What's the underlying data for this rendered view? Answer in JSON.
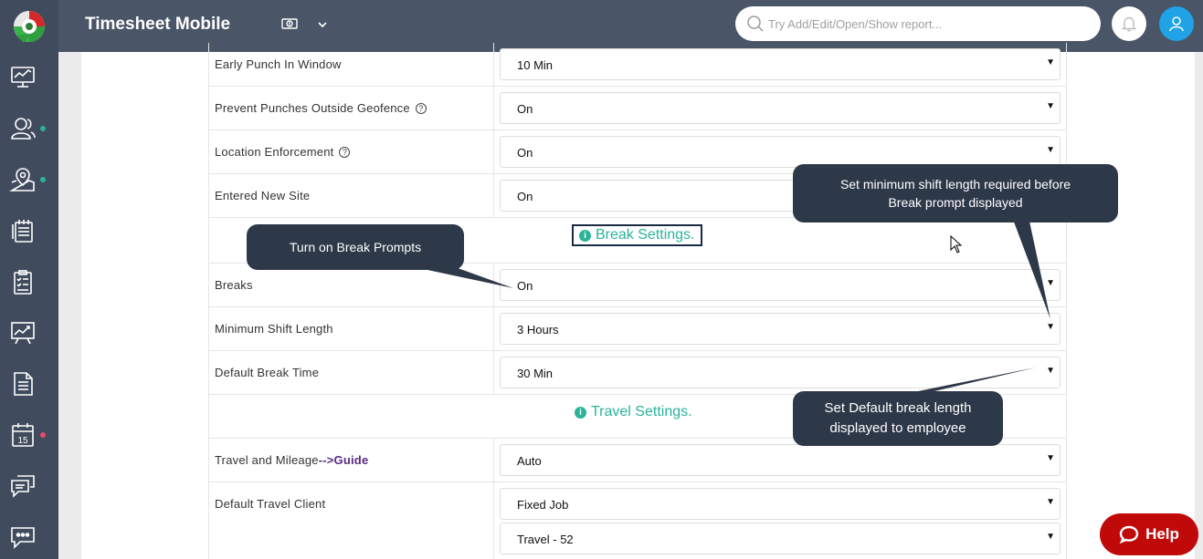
{
  "header": {
    "title": "Timesheet Mobile",
    "search_placeholder": "Try Add/Edit/Open/Show report..."
  },
  "sidebar": {
    "items": [
      {
        "icon": "dashboard-icon"
      },
      {
        "icon": "users-icon",
        "dot": "#2bb39a"
      },
      {
        "icon": "map-pin-icon",
        "dot": "#2bb39a"
      },
      {
        "icon": "timesheet-icon"
      },
      {
        "icon": "clipboard-icon"
      },
      {
        "icon": "chart-icon"
      },
      {
        "icon": "document-icon"
      },
      {
        "icon": "calendar-icon",
        "calendar_day": "15",
        "dot": "#e84a6a"
      },
      {
        "icon": "messages-icon"
      },
      {
        "icon": "chat-icon"
      }
    ]
  },
  "settings": {
    "early_punch": {
      "label": "Early Punch In Window",
      "value": "10 Min"
    },
    "prevent_punches": {
      "label": "Prevent Punches Outside Geofence",
      "value": "On",
      "help": "?"
    },
    "location_enforcement": {
      "label": "Location Enforcement",
      "value": "On",
      "help": "?"
    },
    "entered_new_site": {
      "label": "Entered New Site",
      "value": "On"
    },
    "break_section": {
      "title": "Break Settings.",
      "info": "i"
    },
    "breaks": {
      "label": "Breaks",
      "value": "On"
    },
    "min_shift": {
      "label": "Minimum Shift Length",
      "value": "3 Hours"
    },
    "default_break": {
      "label": "Default Break Time",
      "value": "30 Min"
    },
    "travel_section": {
      "title": "Travel Settings.",
      "info": "i"
    },
    "travel_mileage": {
      "label": "Travel and Mileage",
      "link": "-->Guide",
      "value": "Auto"
    },
    "default_travel_client": {
      "label": "Default Travel Client",
      "value": "Fixed Job",
      "value2": "Travel - 52"
    }
  },
  "callouts": {
    "break_prompts": "Turn on Break Prompts",
    "min_shift_line1": "Set minimum shift length required before",
    "min_shift_line2": "Break prompt displayed",
    "default_break_line1": "Set Default break length",
    "default_break_line2": "displayed to employee"
  },
  "help_button": {
    "label": "Help"
  },
  "colors": {
    "accent": "#2bb39a",
    "header": "#4a5568",
    "sidebar": "#404b5d",
    "help": "#c00a0a",
    "callout": "#2d3848"
  }
}
